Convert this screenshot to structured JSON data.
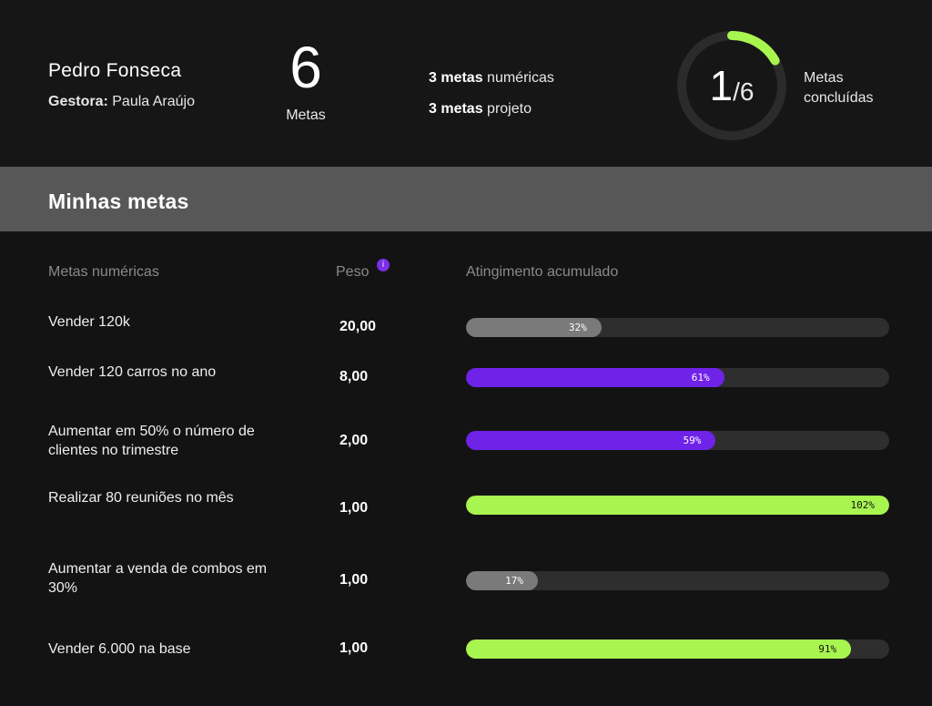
{
  "header": {
    "user_name": "Pedro Fonseca",
    "manager_label": "Gestora:",
    "manager_name": "Paula Araújo",
    "total_goals": "6",
    "total_goals_label": "Metas",
    "numeric_count": "3 metas",
    "numeric_label": "numéricas",
    "project_count": "3 metas",
    "project_label": "projeto",
    "completed": "1",
    "completed_sep": "/6",
    "completed_fraction": 0.1667,
    "completed_caption": "Metas concluídas"
  },
  "section": {
    "title": "Minhas metas"
  },
  "table": {
    "col_goal": "Metas numéricas",
    "col_weight": "Peso",
    "info_icon": "i",
    "col_progress": "Atingimento acumulado"
  },
  "goals": [
    {
      "name": "Vender 120k",
      "weight": "20,00",
      "progress": 32,
      "progress_label": "32%",
      "color": "#7a7a7a",
      "label_color": "#ffffff"
    },
    {
      "name": "Vender 120 carros no ano",
      "weight": "8,00",
      "progress": 61,
      "progress_label": "61%",
      "color": "#6f22e8",
      "label_color": "#ffffff"
    },
    {
      "name": "Aumentar em 50% o número de clientes no trimestre",
      "weight": "2,00",
      "progress": 59,
      "progress_label": "59%",
      "color": "#6f22e8",
      "label_color": "#ffffff"
    },
    {
      "name": "Realizar 80 reuniões no mês",
      "weight": "1,00",
      "progress": 100,
      "progress_label": "102%",
      "color": "#a8f54f",
      "label_color": "#111111"
    },
    {
      "name": "Aumentar a venda de combos em 30%",
      "weight": "1,00",
      "progress": 17,
      "progress_label": "17%",
      "color": "#7a7a7a",
      "label_color": "#ffffff"
    },
    {
      "name": "Vender 6.000 na base",
      "weight": "1,00",
      "progress": 91,
      "progress_label": "91%",
      "color": "#a8f54f",
      "label_color": "#111111"
    }
  ],
  "colors": {
    "accent_green": "#a8f54f",
    "accent_purple": "#6f22e8",
    "neutral_bar": "#7a7a7a",
    "track": "#2f2e2f"
  }
}
